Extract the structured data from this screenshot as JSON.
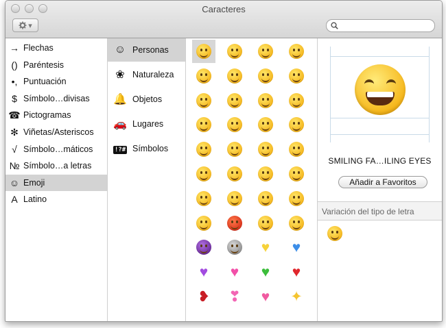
{
  "window": {
    "title": "Caracteres"
  },
  "toolbar": {
    "gear_arrow": "▾"
  },
  "search": {
    "placeholder": ""
  },
  "categories": [
    {
      "icon": "→",
      "label": "Flechas"
    },
    {
      "icon": "()",
      "label": "Paréntesis"
    },
    {
      "icon": "•,",
      "label": "Puntuación"
    },
    {
      "icon": "$",
      "label": "Símbolo…divisas"
    },
    {
      "icon": "☎",
      "label": "Pictogramas"
    },
    {
      "icon": "✻",
      "label": "Viñetas/Asteriscos"
    },
    {
      "icon": "√",
      "label": "Símbolo…máticos"
    },
    {
      "icon": "№",
      "label": "Símbolo…a letras"
    },
    {
      "icon": "☺",
      "label": "Emoji",
      "selected": true
    },
    {
      "icon": "A",
      "label": "Latino"
    }
  ],
  "subcategories": [
    {
      "icon": "☺",
      "label": "Personas",
      "selected": true
    },
    {
      "icon": "❀",
      "label": "Naturaleza"
    },
    {
      "icon": "🔔",
      "label": "Objetos"
    },
    {
      "icon": "🚗",
      "label": "Lugares"
    },
    {
      "icon": "!?#",
      "label": "Símbolos"
    }
  ],
  "emoji_grid": [
    [
      "face",
      "face",
      "face",
      "face"
    ],
    [
      "face",
      "face",
      "face",
      "face"
    ],
    [
      "face",
      "face",
      "face",
      "face"
    ],
    [
      "face",
      "face",
      "face",
      "face"
    ],
    [
      "face",
      "face",
      "face",
      "face"
    ],
    [
      "face",
      "face",
      "face",
      "face"
    ],
    [
      "face",
      "face",
      "face",
      "face"
    ],
    [
      "face",
      "angry",
      "face",
      "face"
    ],
    [
      "devil",
      "alien",
      "yellow-heart",
      "blue-heart"
    ],
    [
      "purple-heart",
      "pink-heart",
      "green-heart",
      "red-heart"
    ],
    [
      "broken-heart",
      "heart-ribbon",
      "heart-arrow",
      "sparkles"
    ]
  ],
  "colors": {
    "yellow-heart": "#f6d23a",
    "blue-heart": "#3d8ee8",
    "purple-heart": "#a24be0",
    "pink-heart": "#f24fa8",
    "green-heart": "#3bbd3a",
    "red-heart": "#e0262c",
    "broken-heart": "#c81d25",
    "heart-ribbon": "#f266b4",
    "heart-arrow": "#f05aa0",
    "sparkles": "#f4c430"
  },
  "detail": {
    "char_name": "SMILING FA…ILING EYES",
    "fav_button": "Añadir a Favoritos",
    "variation_header": "Variación del tipo de letra"
  }
}
